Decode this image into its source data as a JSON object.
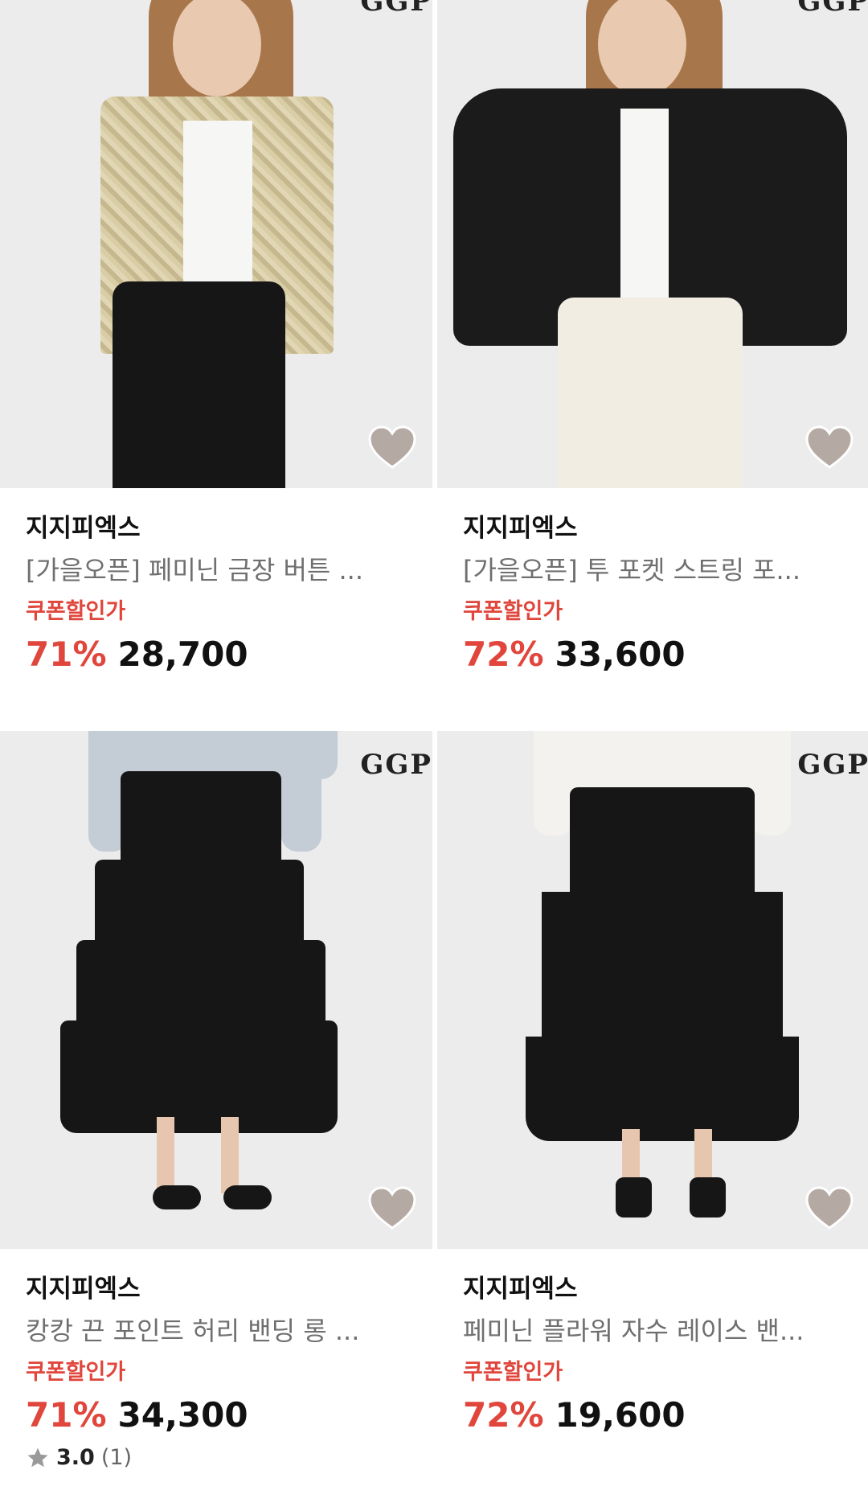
{
  "products": [
    {
      "brand": "지지피엑스",
      "title": "[가을오픈] 페미닌 금장 버튼 ...",
      "coupon_label": "쿠폰할인가",
      "discount": "71%",
      "price": "28,700",
      "watermark": "GGP",
      "image_icon": "tweed-jacket-model-image",
      "wishlist_icon": "heart-icon"
    },
    {
      "brand": "지지피엑스",
      "title": "[가을오픈] 투 포켓 스트링 포...",
      "coupon_label": "쿠폰할인가",
      "discount": "72%",
      "price": "33,600",
      "watermark": "GGP",
      "image_icon": "black-jacket-model-image",
      "wishlist_icon": "heart-icon"
    },
    {
      "brand": "지지피엑스",
      "title": "캉캉 끈 포인트 허리 밴딩 롱 ...",
      "coupon_label": "쿠폰할인가",
      "discount": "71%",
      "price": "34,300",
      "watermark": "GGP",
      "image_icon": "tiered-skirt-model-image",
      "wishlist_icon": "heart-icon",
      "rating": {
        "score": "3.0",
        "count": "(1)"
      }
    },
    {
      "brand": "지지피엑스",
      "title": "페미닌 플라워 자수 레이스 밴...",
      "coupon_label": "쿠폰할인가",
      "discount": "72%",
      "price": "19,600",
      "watermark": "GGP",
      "image_icon": "lace-skirt-model-image",
      "wishlist_icon": "heart-icon"
    }
  ],
  "colors": {
    "accent_red": "#e0463c",
    "image_bg": "#ececec",
    "heart_fill": "#b5aaa3"
  }
}
